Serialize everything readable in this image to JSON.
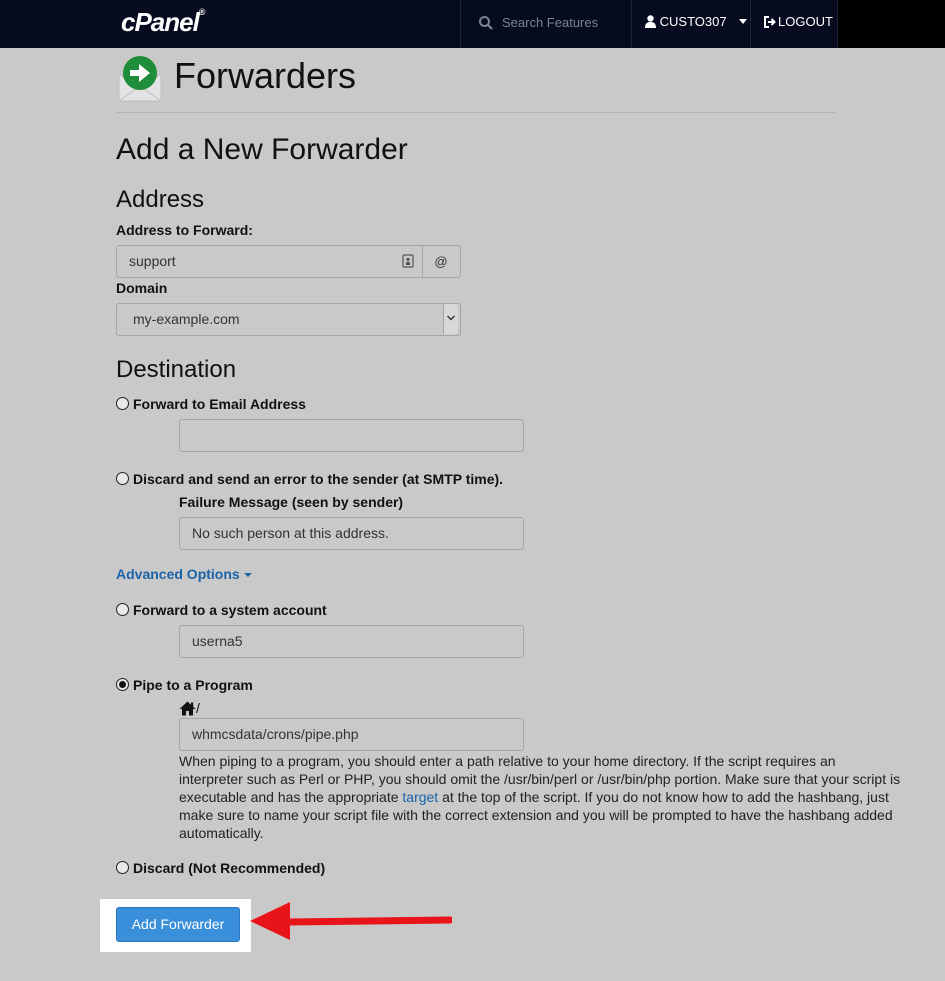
{
  "header": {
    "logo": "cPanel",
    "logo_mark": "®",
    "search_placeholder": "Search Features",
    "username": "CUSTO307",
    "logout": "LOGOUT"
  },
  "page": {
    "title": "Forwarders",
    "section_title": "Add a New Forwarder"
  },
  "address": {
    "heading": "Address",
    "address_label": "Address to Forward:",
    "address_value": "support",
    "at_symbol": "@",
    "domain_label": "Domain",
    "domain_value": "my-example.com"
  },
  "destination": {
    "heading": "Destination",
    "forward_email_label": "Forward to Email Address",
    "forward_email_value": "",
    "discard_error_label": "Discard and send an error to the sender (at SMTP time).",
    "failure_message_label": "Failure Message (seen by sender)",
    "failure_message_value": "No such person at this address.",
    "advanced_options": "Advanced Options",
    "system_account_label": "Forward to a system account",
    "system_account_value": "userna5",
    "pipe_label": "Pipe to a Program",
    "pipe_prefix": "/",
    "pipe_value": "whmcsdata/crons/pipe.php",
    "help_before_link": "When piping to a program, you should enter a path relative to your home directory. If the script requires an interpreter such as Perl or PHP, you should omit the /usr/bin/perl or /usr/bin/php portion. Make sure that your script is executable and has the appropriate ",
    "help_link": "target",
    "help_after_link": " at the top of the script. If you do not know how to add the hashbang, just make sure to name your script file with the correct extension and you will be prompted to have the hashbang added automatically.",
    "discard_label": "Discard (Not Recommended)",
    "selected": "pipe"
  },
  "actions": {
    "submit": "Add Forwarder"
  },
  "colors": {
    "header_bg": "#060b1f",
    "page_bg": "#c9c9c9",
    "link": "#1a63a8",
    "button": "#3a8fda",
    "annotation_arrow": "#e8141a"
  }
}
